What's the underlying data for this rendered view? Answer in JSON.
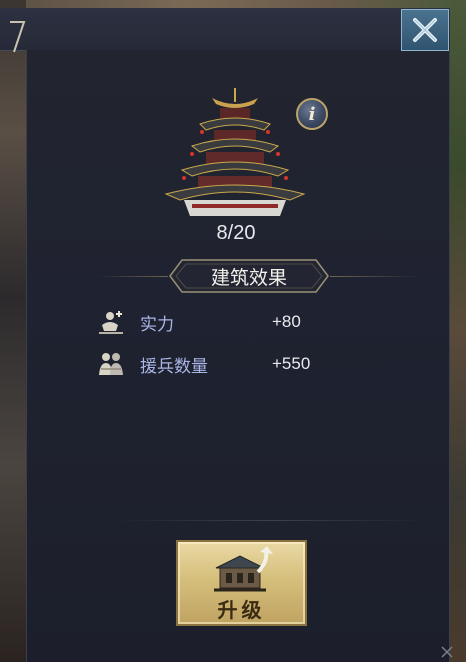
{
  "panel": {
    "close_icon": "close-x-icon",
    "info_icon": "info-icon",
    "info_glyph": "i"
  },
  "building": {
    "icon": "pagoda-tower-icon",
    "level_text": "8/20"
  },
  "effects": {
    "title": "建筑效果",
    "items": [
      {
        "icon": "power-icon",
        "label": "实力",
        "value": "+80"
      },
      {
        "icon": "reinforcement-troops-icon",
        "label": "援兵数量",
        "value": "+550"
      }
    ]
  },
  "upgrade": {
    "icon": "building-upgrade-icon",
    "label": "升级"
  },
  "colors": {
    "panel_bg": "#1f2230",
    "stat_label": "#a9b6e6",
    "close_button": "#3a6380",
    "upgrade_button": "#d6bf7c"
  }
}
